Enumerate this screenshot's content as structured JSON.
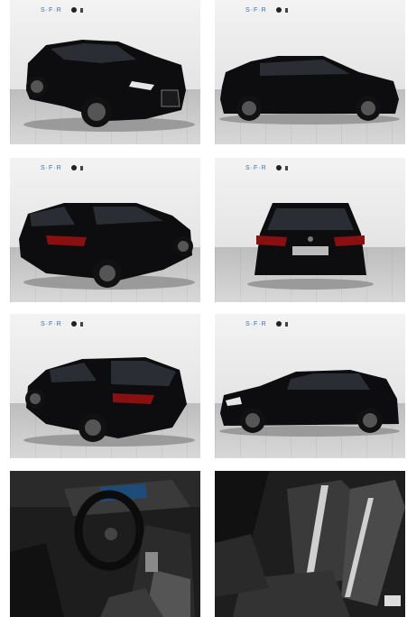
{
  "gallery": {
    "photos": [
      {
        "id": "front-three-quarter",
        "scene": "showroom"
      },
      {
        "id": "side-right",
        "scene": "showroom"
      },
      {
        "id": "rear-three-quarter-left",
        "scene": "showroom"
      },
      {
        "id": "rear",
        "scene": "showroom"
      },
      {
        "id": "rear-three-quarter-right",
        "scene": "showroom"
      },
      {
        "id": "side-left",
        "scene": "showroom"
      },
      {
        "id": "interior-dashboard",
        "scene": "interior"
      },
      {
        "id": "interior-front-seat",
        "scene": "interior"
      }
    ]
  },
  "colors": {
    "car_body": "#0d0d10",
    "wall": "#ededed",
    "floor": "#c8c8c8",
    "seat_stripe": "#d0d0d0"
  }
}
